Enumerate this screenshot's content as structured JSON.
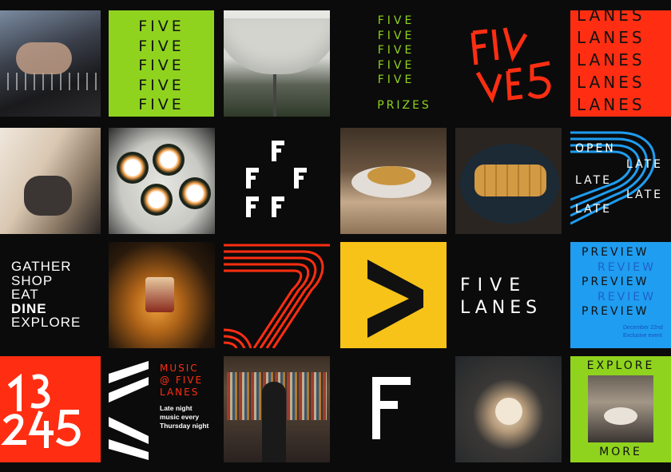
{
  "colors": {
    "green": "#8fd31e",
    "red": "#ff2e12",
    "yellow": "#f7c318",
    "blue": "#1f9df0",
    "white": "#ffffff",
    "black": "#0b0b0b"
  },
  "tiles": {
    "five_green": {
      "lines": [
        "FIVE",
        "FIVE",
        "FIVE",
        "FIVE",
        "FIVE"
      ]
    },
    "five_prizes": {
      "lines": [
        "FIVE",
        "FIVE",
        "FIVE",
        "FIVE",
        "FIVE"
      ],
      "footer": "PRIZES"
    },
    "five_logo": {
      "top": "FI/V",
      "bottom": "VE5"
    },
    "lanes_red": {
      "lines": [
        "LANES",
        "LANES",
        "LANES",
        "LANES",
        "LANES"
      ]
    },
    "open_late": {
      "lines": [
        "OPEN",
        "LATE",
        "LATE",
        "LATE",
        "LATE"
      ]
    },
    "gather": {
      "lines": [
        "GATHER",
        "SHOP",
        "EAT",
        "DINE",
        "EXPLORE"
      ],
      "bold_index": 3
    },
    "five_lanes_word": {
      "line1": "FIVE",
      "line2": "LANES"
    },
    "preview": {
      "lines": [
        "PREVIEW",
        "REVIEW",
        "PREVIEW",
        "REVIEW",
        "PREVIEW"
      ],
      "caption1": "December 22nd",
      "caption2": "Exclusive event"
    },
    "numbers": {
      "text": "1 3 2 4 5"
    },
    "music": {
      "title1": "MUSIC",
      "title2": "@ FIVE",
      "title3": "LANES",
      "sub1": "Late night",
      "sub2": "music every",
      "sub3": "Thursday night"
    },
    "explore_more": {
      "top": "EXPLORE",
      "bottom": "MORE"
    }
  },
  "photos": [
    "keyboard-photo",
    "umbrella-photo",
    "clothes-photo",
    "sushi-photo",
    "dinner-photo",
    "katsu-photo",
    "cocktail-photo",
    "bookstore-photo",
    "dessert-photo",
    "restaurant-photo"
  ]
}
